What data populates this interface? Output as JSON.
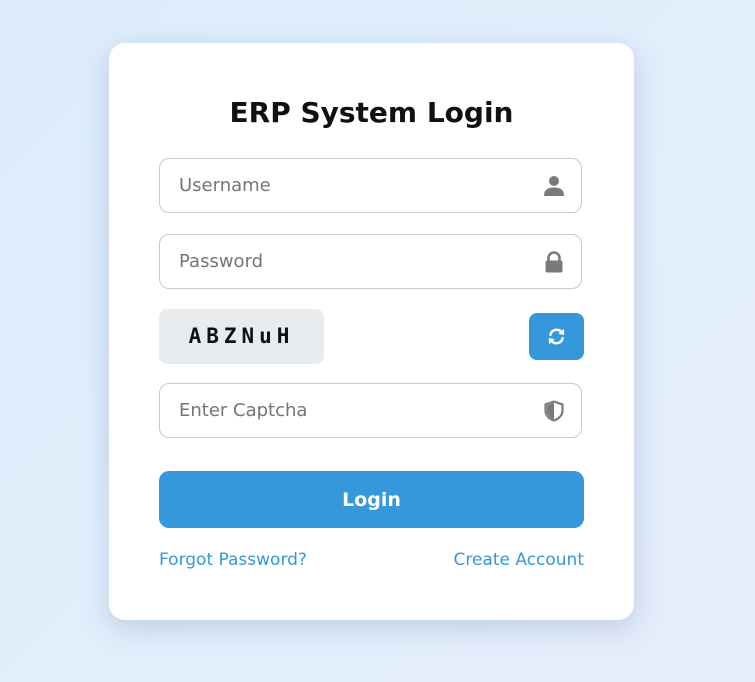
{
  "login": {
    "title": "ERP System Login",
    "username_placeholder": "Username",
    "password_placeholder": "Password",
    "captcha_text": "ABZNuH",
    "captcha_input_placeholder": "Enter Captcha",
    "login_label": "Login",
    "forgot_label": "Forgot Password?",
    "create_label": "Create Account"
  },
  "icons": {
    "username": "user-icon",
    "password": "lock-icon",
    "captcha": "shield-icon",
    "refresh": "refresh-icon"
  },
  "colors": {
    "accent": "#3498db",
    "icon_gray": "#7a7a7a",
    "captcha_bg": "#e9ecef"
  }
}
